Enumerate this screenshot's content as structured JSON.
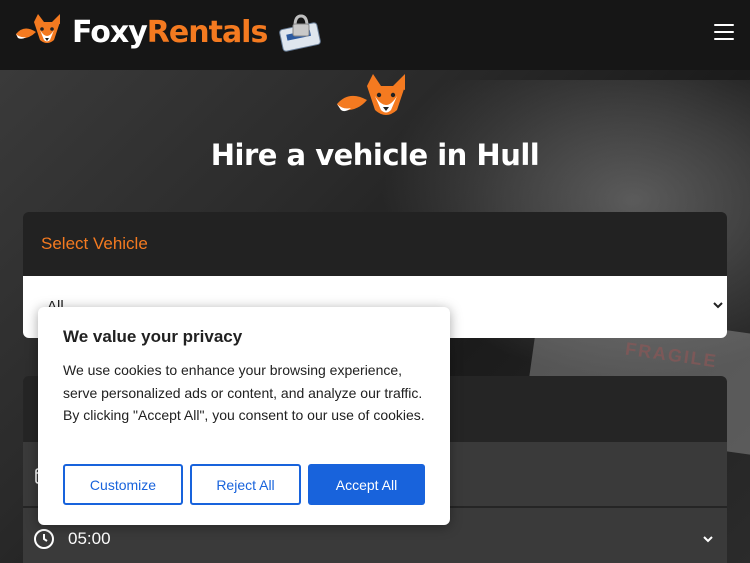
{
  "header": {
    "brand_part1": "Foxy",
    "brand_part2": "Rentals",
    "menu_icon": "hamburger-menu-icon"
  },
  "hero": {
    "title": "Hire a vehicle in Hull",
    "background_text": "FRAGILE"
  },
  "vehicle_card": {
    "title": "Select Vehicle",
    "select_value": "All"
  },
  "date_card": {
    "time_value": "05:00"
  },
  "cookie_banner": {
    "title": "We value your privacy",
    "text": "We use cookies to enhance your browsing experience, serve personalized ads or content, and analyze our traffic. By clicking \"Accept All\", you consent to our use of cookies.",
    "customize_label": "Customize",
    "reject_label": "Reject All",
    "accept_label": "Accept All"
  },
  "colors": {
    "brand_orange": "#f47a20",
    "cookie_blue": "#1863dc",
    "header_bg": "#161616"
  }
}
